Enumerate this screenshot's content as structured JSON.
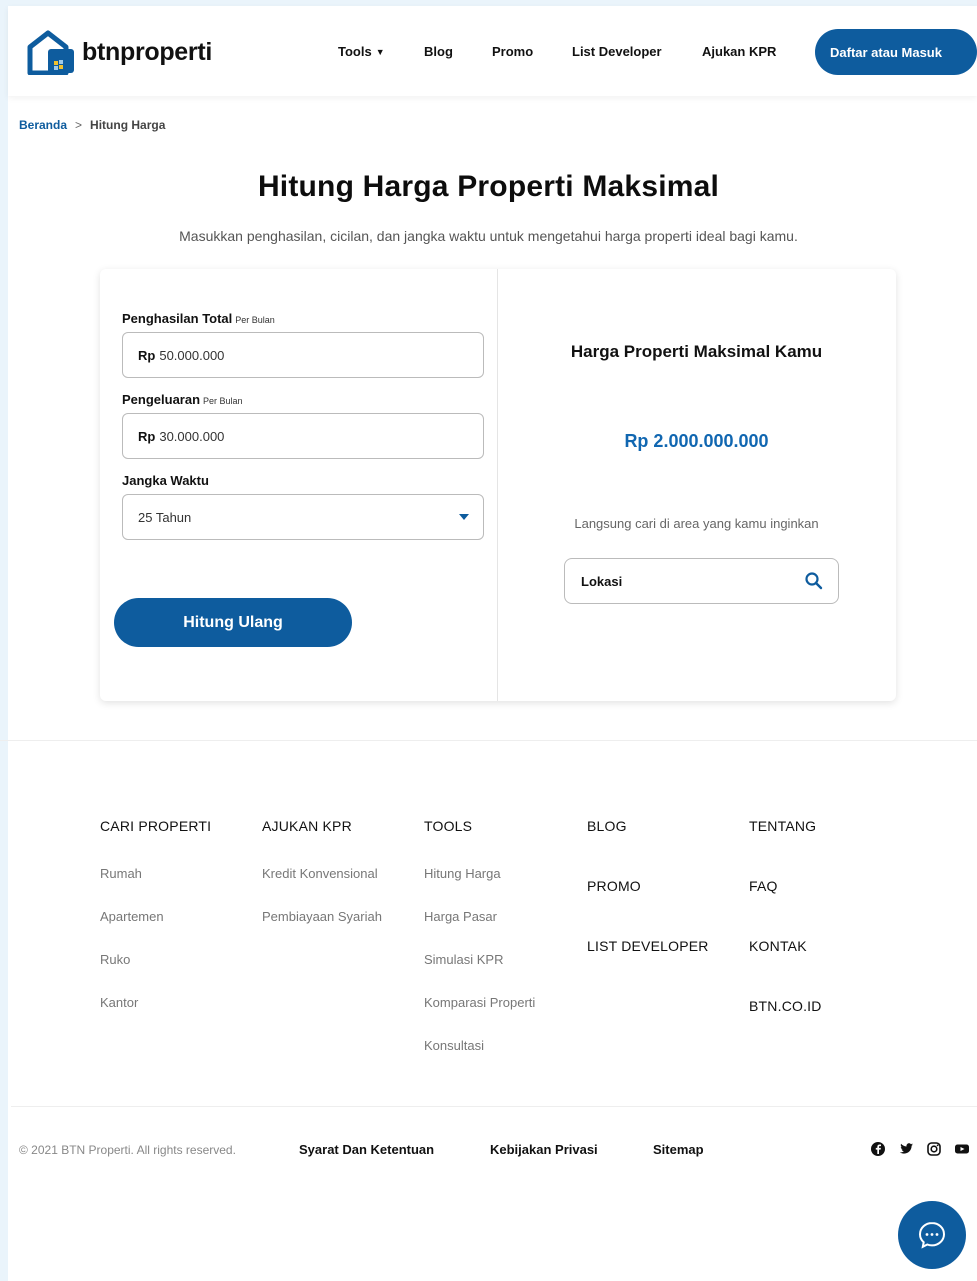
{
  "header": {
    "logo_text": "btnproperti",
    "nav": [
      {
        "label": "Tools",
        "has_dropdown": true
      },
      {
        "label": "Blog"
      },
      {
        "label": "Promo"
      },
      {
        "label": "List Developer"
      },
      {
        "label": "Ajukan KPR"
      }
    ],
    "login_label": "Daftar atau Masuk"
  },
  "breadcrumb": {
    "home": "Beranda",
    "separator": ">",
    "current": "Hitung Harga"
  },
  "page": {
    "title": "Hitung Harga Properti Maksimal",
    "subtitle": "Masukkan penghasilan, cicilan, dan jangka waktu untuk mengetahui harga properti ideal bagi kamu."
  },
  "form": {
    "income": {
      "label": "Penghasilan Total",
      "suffix": "Per Bulan",
      "currency": "Rp",
      "value": "50.000.000"
    },
    "expense": {
      "label": "Pengeluaran",
      "suffix": "Per Bulan",
      "currency": "Rp",
      "value": "30.000.000"
    },
    "term": {
      "label": "Jangka Waktu",
      "value": "25 Tahun"
    },
    "submit_label": "Hitung Ulang"
  },
  "result": {
    "title": "Harga Properti Maksimal Kamu",
    "value": "Rp 2.000.000.000",
    "hint": "Langsung cari di area yang kamu inginkan",
    "location_placeholder": "Lokasi"
  },
  "footer": {
    "columns": [
      {
        "heading": "CARI PROPERTI",
        "links": [
          "Rumah",
          "Apartemen",
          "Ruko",
          "Kantor"
        ]
      },
      {
        "heading": "AJUKAN KPR",
        "links": [
          "Kredit Konvensional",
          "Pembiayaan Syariah"
        ]
      },
      {
        "heading": "TOOLS",
        "links": [
          "Hitung Harga",
          "Harga Pasar",
          "Simulasi KPR",
          "Komparasi Properti",
          "Konsultasi"
        ]
      }
    ],
    "blog_col": [
      "BLOG",
      "PROMO",
      "LIST DEVELOPER"
    ],
    "about_col": [
      "TENTANG",
      "FAQ",
      "KONTAK",
      "BTN.CO.ID"
    ],
    "copyright": "© 2021 BTN Properti. All rights reserved.",
    "bottom_links": [
      "Syarat Dan Ketentuan",
      "Kebijakan Privasi",
      "Sitemap"
    ],
    "social_icons": [
      "facebook-icon",
      "twitter-icon",
      "instagram-icon",
      "youtube-icon"
    ]
  },
  "colors": {
    "brand_blue": "#0e5c9e",
    "value_blue": "#1167b1"
  }
}
